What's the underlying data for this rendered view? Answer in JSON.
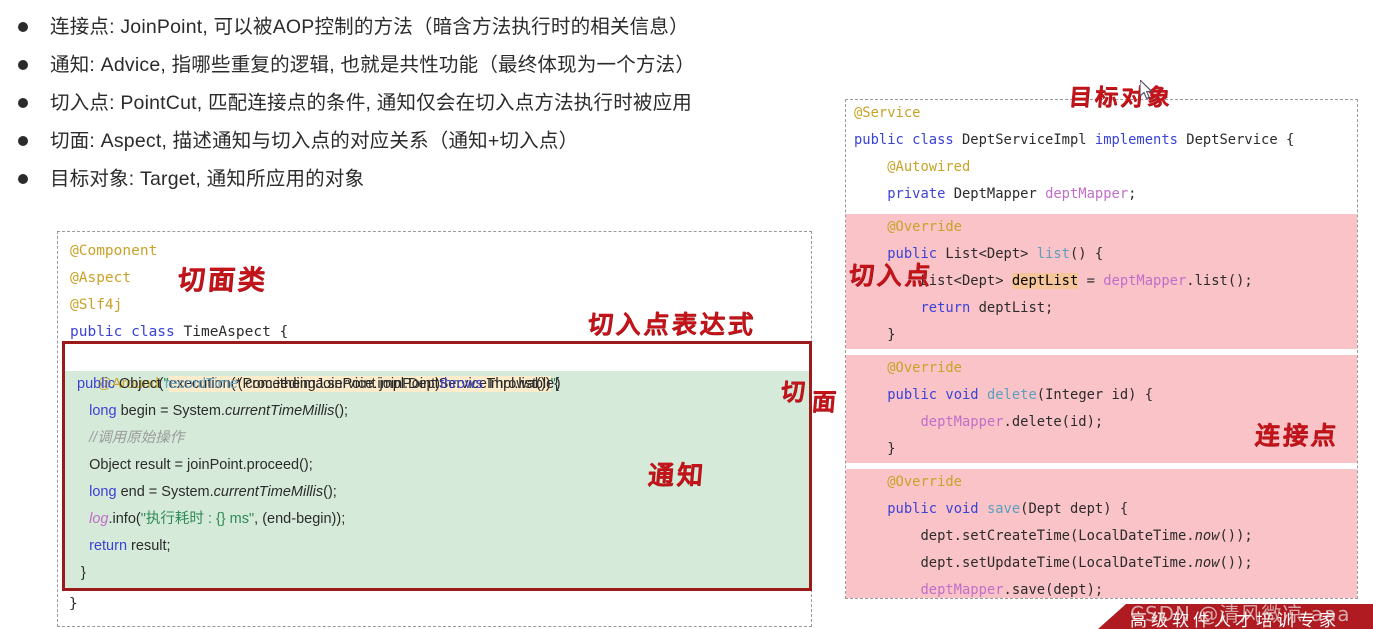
{
  "bullets": [
    {
      "text": "连接点: JoinPoint, 可以被AOP控制的方法（暗含方法执行时的相关信息）"
    },
    {
      "text": "通知: Advice, 指哪些重复的逻辑, 也就是共性功能（最终体现为一个方法）"
    },
    {
      "text": "切入点: PointCut, 匹配连接点的条件, 通知仅会在切入点方法执行时被应用"
    },
    {
      "text": "切面: Aspect, 描述通知与切入点的对应关系（通知+切入点）"
    },
    {
      "text": "目标对象: Target, 通知所应用的对象"
    }
  ],
  "left_code": {
    "header_lines": [
      "@Component",
      "@Aspect",
      "@Slf4j",
      "public class TimeAspect {"
    ],
    "around_line": "@Around(\"execution(* com.itheima.service.impl.DeptServiceImpl.list())\")",
    "around_highlight": "execution(* com.itheima.service.impl.DeptServiceImpl.list())",
    "body_lines": [
      "public Object recordTime(ProceedingJoinPoint joinPoint)throws Throwable{",
      "long begin = System.currentTimeMillis();",
      "//调用原始操作",
      "Object result = joinPoint.proceed();",
      "long end = System.currentTimeMillis();",
      "log.info(\"执行耗时 : {} ms\", (end-begin));",
      "return result;",
      "}"
    ],
    "footer_line": "}"
  },
  "right_code": {
    "lines": [
      "@Service",
      "public class DeptServiceImpl implements DeptService {",
      "@Autowired",
      "private DeptMapper deptMapper;",
      "@Override",
      "public List<Dept> list() {",
      "List<Dept> deptList = deptMapper.list();",
      "return deptList;",
      "}",
      "@Override",
      "public void delete(Integer id) {",
      "deptMapper.delete(id);",
      "}",
      "@Override",
      "public void save(Dept dept) {",
      "dept.setCreateTime(LocalDateTime.now());",
      "dept.setUpdateTime(LocalDateTime.now());",
      "deptMapper.save(dept);",
      "}"
    ],
    "highlight_token": "deptList"
  },
  "annotations": {
    "aspect_class": "切面类",
    "pointcut_expression": "切入点表达式",
    "aspect_a": "切",
    "aspect_b": "面",
    "advice": "通知",
    "target_object": "目标对象",
    "pointcut": "切入点",
    "join_point": "连接点"
  },
  "footer": {
    "banner_text": "高级软件人才培训专家",
    "watermark": "CSDN @清风微凉 aaa"
  },
  "colors": {
    "annotation_red": "#c4141a",
    "banner_red": "#b01a21",
    "green_block": "#d5ead9",
    "pink_block": "#fac3c8",
    "orange_highlight": "#fdeccb",
    "red_border": "#9c1a1a"
  }
}
